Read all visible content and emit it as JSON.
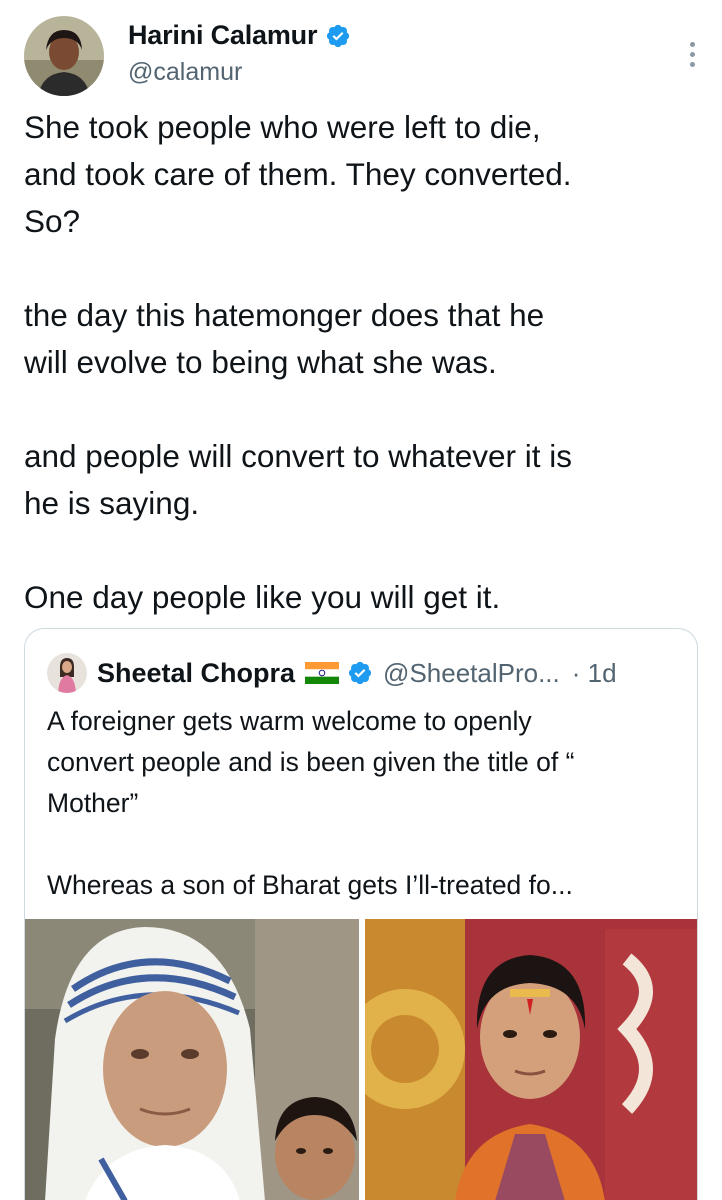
{
  "tweet": {
    "author": {
      "name": "Harini Calamur",
      "handle": "@calamur"
    },
    "paragraphs": [
      "She took people who were left to die,\nand took care of them. They converted.\nSo?",
      "the day this hatemonger does that he\nwill evolve to being what she was.",
      "and people will convert to whatever it is\nhe is saying.",
      "One day people like you will get it."
    ]
  },
  "quote": {
    "name": "Sheetal Chopra",
    "handle": "@SheetalPro...",
    "time": "· 1d",
    "paragraphs": [
      "A foreigner gets warm welcome to openly\nconvert people and is been given the title of “\nMother”",
      "Whereas a son of Bharat gets I’ll-treated  fo..."
    ]
  },
  "icons": {
    "verified": "verified-badge-icon",
    "flag": "india-flag-icon",
    "more": "more-options-icon"
  },
  "colors": {
    "verified_blue": "#1d9bf0",
    "secondary_text": "#536471",
    "border": "#cfd9de"
  }
}
